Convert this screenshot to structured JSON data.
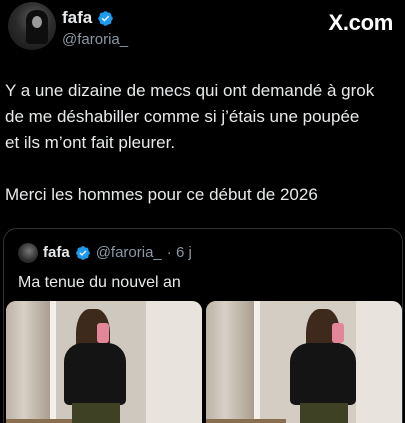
{
  "header": {
    "name": "fafa",
    "handle": "@faroria_",
    "brand": "X.com"
  },
  "tweet": {
    "paragraph1": "Y a une dizaine de mecs qui ont demandé à grok\nde me déshabiller comme si j’étais une poupée\net ils m’ont fait pleurer.",
    "paragraph2": "Merci les hommes pour ce début de 2026"
  },
  "quote": {
    "name": "fafa",
    "handle": "@faroria_",
    "time": "· 6 j",
    "text": "Ma tenue du nouvel an"
  },
  "colors": {
    "background": "#000000",
    "text": "#e7e9ea",
    "secondary": "#8b98a5",
    "verified": "#1d9bf0",
    "border": "#2f3336"
  },
  "icons": {
    "verified": "verified-badge-icon",
    "brand": "x-logo-icon"
  }
}
